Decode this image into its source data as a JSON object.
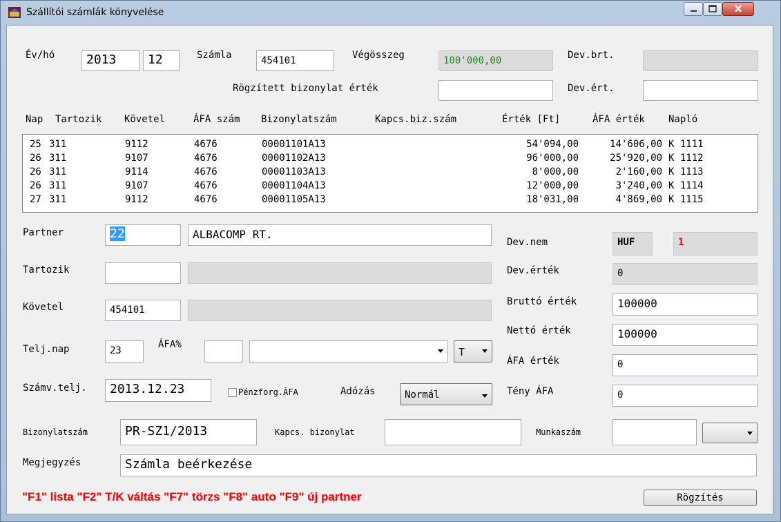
{
  "window": {
    "title": "Szállítói számlák könyvelése"
  },
  "top": {
    "ev_ho_label": "Év/hó",
    "year": "2013",
    "month": "12",
    "szamla_label": "Számla",
    "szamla": "454101",
    "vegosszeg_label": "Végösszeg",
    "vegosszeg": "100'000,00",
    "dev_brt_label": "Dev.brt.",
    "dev_brt": "",
    "rogzitett_label": "Rögzített bizonylat érték",
    "rogzitett": "",
    "dev_ert_label": "Dev.ért.",
    "dev_ert": ""
  },
  "table": {
    "headers": [
      "Nap",
      "Tartozik",
      "Követel",
      "ÁFA szám",
      "Bizonylatszám",
      "Kapcs.biz.szám",
      "Érték [Ft]",
      "ÁFA érték",
      "Napló"
    ],
    "rows": [
      {
        "nap": "25",
        "tartozik": "311",
        "kovetel": "9112",
        "afa_szam": "4676",
        "bizonylat": "00001101A13",
        "kapcs": "",
        "ertek": "54'094,00",
        "afa_ertek": "14'606,00",
        "naplo": "K 1111"
      },
      {
        "nap": "26",
        "tartozik": "311",
        "kovetel": "9107",
        "afa_szam": "4676",
        "bizonylat": "00001102A13",
        "kapcs": "",
        "ertek": "96'000,00",
        "afa_ertek": "25'920,00",
        "naplo": "K 1112"
      },
      {
        "nap": "26",
        "tartozik": "311",
        "kovetel": "9114",
        "afa_szam": "4676",
        "bizonylat": "00001103A13",
        "kapcs": "",
        "ertek": "8'000,00",
        "afa_ertek": "2'160,00",
        "naplo": "K 1113"
      },
      {
        "nap": "26",
        "tartozik": "311",
        "kovetel": "9107",
        "afa_szam": "4676",
        "bizonylat": "00001104A13",
        "kapcs": "",
        "ertek": "12'000,00",
        "afa_ertek": "3'240,00",
        "naplo": "K 1114"
      },
      {
        "nap": "27",
        "tartozik": "311",
        "kovetel": "9112",
        "afa_szam": "4676",
        "bizonylat": "00001105A13",
        "kapcs": "",
        "ertek": "18'031,00",
        "afa_ertek": "4'869,00",
        "naplo": "K 1115"
      }
    ]
  },
  "form": {
    "partner_label": "Partner",
    "partner_code": "22",
    "partner_name": "ALBACOMP RT.",
    "tartozik_label": "Tartozik",
    "tartozik_code": "",
    "tartozik_name": "",
    "kovetel_label": "Követel",
    "kovetel_code": "454101",
    "kovetel_name": "",
    "telj_nap_label": "Telj.nap",
    "telj_nap": "23",
    "afa_pct_label": "ÁFA%",
    "afa_pct": "",
    "afa_combo": "",
    "tk_combo": "T",
    "szamv_telj_label": "Számv.telj.",
    "szamv_telj": "2013.12.23",
    "penzforg_label": "Pénzforg.ÁFA",
    "adozas_label": "Adózás",
    "adozas": "Normál",
    "bizonylatszam_label": "Bizonylatszám",
    "bizonylatszam": "PR-SZ1/2013",
    "kapcs_label": "Kapcs. bizonylat",
    "kapcs": "",
    "munkaszam_label": "Munkaszám",
    "munkaszam": "",
    "munkaszam_combo": "",
    "megjegyzes_label": "Megjegyzés",
    "megjegyzes": "Számla beérkezése"
  },
  "right": {
    "dev_nem_label": "Dev.nem",
    "dev_nem": "HUF",
    "dev_nem_code": "1",
    "dev_ertek_label": "Dev.érték",
    "dev_ertek": "0",
    "brutto_label": "Bruttó érték",
    "brutto": "100000",
    "netto_label": "Nettó érték",
    "netto": "100000",
    "afa_ertek_label": "ÁFA érték",
    "afa_ertek": "0",
    "teny_afa_label": "Tény ÁFA",
    "teny_afa": "0"
  },
  "footer": {
    "hint": "\"F1\" lista \"F2\" T/K váltás \"F7\" törzs \"F8\" auto \"F9\" új partner",
    "submit": "Rögzítés"
  },
  "colors": {
    "vegosszeg_text": "#1a8a1a",
    "dev_nem_code_text": "#ff0000",
    "hint_text": "#ff0000"
  }
}
